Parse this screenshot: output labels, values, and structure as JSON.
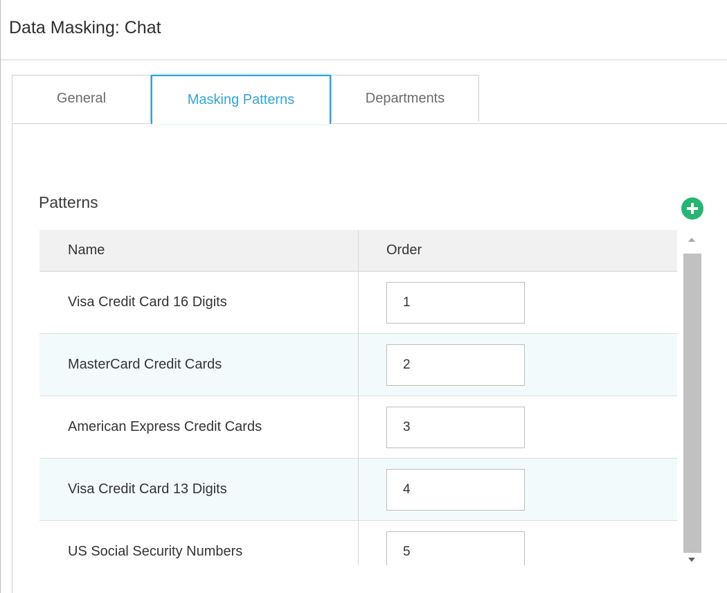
{
  "header": {
    "title": "Data Masking: Chat"
  },
  "tabs": [
    {
      "label": "General",
      "active": false
    },
    {
      "label": "Masking Patterns",
      "active": true
    },
    {
      "label": "Departments",
      "active": false
    }
  ],
  "patterns": {
    "title": "Patterns",
    "add_icon": "plus-circle-icon",
    "columns": {
      "name": "Name",
      "order": "Order"
    },
    "rows": [
      {
        "name": "Visa Credit Card 16 Digits",
        "order": "1"
      },
      {
        "name": "MasterCard Credit Cards",
        "order": "2"
      },
      {
        "name": "American Express Credit Cards",
        "order": "3"
      },
      {
        "name": "Visa Credit Card 13 Digits",
        "order": "4"
      },
      {
        "name": "US Social Security Numbers",
        "order": "5"
      }
    ]
  },
  "colors": {
    "accent": "#2aa3d6",
    "add_button": "#26b573",
    "alt_row": "#f3fafc"
  }
}
